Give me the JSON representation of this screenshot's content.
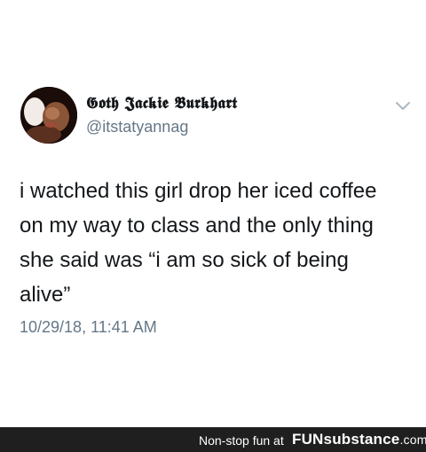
{
  "tweet": {
    "display_name": "𝕲𝖔𝖙𝖍 𝕵𝖆𝖈𝖐𝖎𝖊 𝕭𝖚𝖗𝖐𝖍𝖆𝖗𝖙",
    "handle": "@itstatyannag",
    "text": "i watched this girl drop her iced coffee\non my way to class and the only thing\nshe said was “i am so sick of being\nalive”",
    "timestamp": "10/29/18, 11:41 AM"
  },
  "footer": {
    "tagline": "Non-stop fun at",
    "logo": "FUNsubstance",
    "logo_domain": ".com"
  },
  "icons": {
    "menu": "chevron-down-icon",
    "avatar": "profile-photo"
  },
  "colors": {
    "text": "#14171a",
    "secondary_text": "#657786",
    "footer_background": "#1f1f1f"
  }
}
